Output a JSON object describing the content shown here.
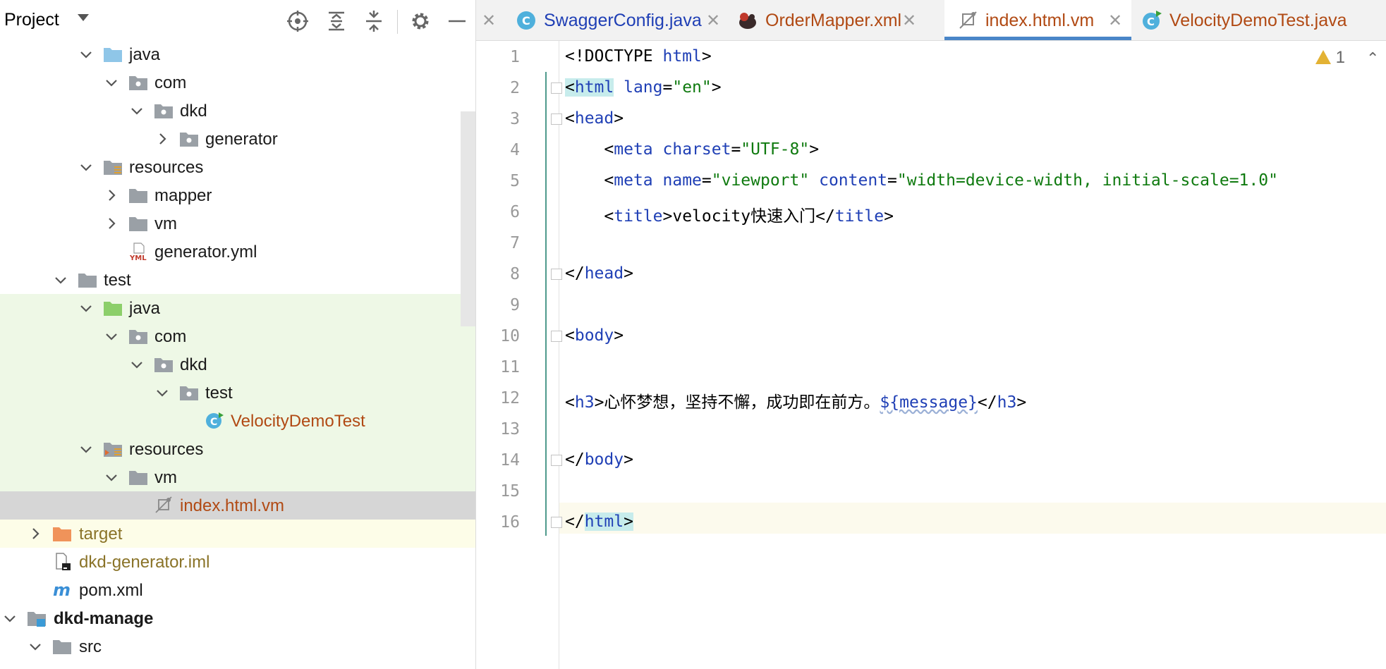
{
  "project_panel": {
    "title": "Project"
  },
  "tree": [
    {
      "label": "java",
      "type": "folder-blue",
      "expanded": true
    },
    {
      "label": "com",
      "type": "package",
      "expanded": true
    },
    {
      "label": "dkd",
      "type": "package",
      "expanded": true
    },
    {
      "label": "generator",
      "type": "package",
      "expanded": false
    },
    {
      "label": "resources",
      "type": "resources-folder",
      "expanded": true
    },
    {
      "label": "mapper",
      "type": "folder",
      "expanded": false
    },
    {
      "label": "vm",
      "type": "folder",
      "expanded": false
    },
    {
      "label": "generator.yml",
      "type": "yml-file"
    },
    {
      "label": "test",
      "type": "folder",
      "expanded": true
    },
    {
      "label": "java",
      "type": "folder-green",
      "expanded": true
    },
    {
      "label": "com",
      "type": "package",
      "expanded": true
    },
    {
      "label": "dkd",
      "type": "package",
      "expanded": true
    },
    {
      "label": "test",
      "type": "package",
      "expanded": true
    },
    {
      "label": "VelocityDemoTest",
      "type": "test-class"
    },
    {
      "label": "resources",
      "type": "test-resources-folder",
      "expanded": true
    },
    {
      "label": "vm",
      "type": "folder",
      "expanded": true
    },
    {
      "label": "index.html.vm",
      "type": "vm-file"
    },
    {
      "label": "target",
      "type": "folder-orange",
      "expanded": false
    },
    {
      "label": "dkd-generator.iml",
      "type": "iml-file"
    },
    {
      "label": "pom.xml",
      "type": "maven-file"
    },
    {
      "label": "dkd-manage",
      "type": "module",
      "expanded": true
    },
    {
      "label": "src",
      "type": "folder",
      "expanded": true
    }
  ],
  "tabs": [
    {
      "label": "SwaggerConfig.java",
      "icon": "class-icon"
    },
    {
      "label": "OrderMapper.xml",
      "icon": "mybatis-icon"
    },
    {
      "label": "index.html.vm",
      "icon": "vm-file-icon"
    },
    {
      "label": "VelocityDemoTest.java",
      "icon": "test-class-icon"
    }
  ],
  "editor": {
    "warning_count": "1",
    "line_numbers": [
      "1",
      "2",
      "3",
      "4",
      "5",
      "6",
      "7",
      "8",
      "9",
      "10",
      "11",
      "12",
      "13",
      "14",
      "15",
      "16"
    ],
    "lines": {
      "l1_a": "<!DOCTYPE ",
      "l1_b": "html",
      "l1_c": ">",
      "l2_a": "<",
      "l2_b": "html",
      "l2_c": " ",
      "l2_d": "lang",
      "l2_e": "=",
      "l2_f": "\"en\"",
      "l2_g": ">",
      "l3_a": "<",
      "l3_b": "head",
      "l3_c": ">",
      "l4_a": "    <",
      "l4_b": "meta",
      "l4_c": " ",
      "l4_d": "charset",
      "l4_e": "=",
      "l4_f": "\"UTF-8\"",
      "l4_g": ">",
      "l5_a": "    <",
      "l5_b": "meta",
      "l5_c": " ",
      "l5_d": "name",
      "l5_e": "=",
      "l5_f": "\"viewport\"",
      "l5_g": " ",
      "l5_h": "content",
      "l5_i": "=",
      "l5_j": "\"width=device-width, initial-scale=1.0\"",
      "l6_a": "    <",
      "l6_b": "title",
      "l6_c": ">velocity快速入门</",
      "l6_d": "title",
      "l6_e": ">",
      "l8_a": "</",
      "l8_b": "head",
      "l8_c": ">",
      "l10_a": "<",
      "l10_b": "body",
      "l10_c": ">",
      "l12_a": "<",
      "l12_b": "h3",
      "l12_c": ">心怀梦想，坚持不懈，成功即在前方。",
      "l12_d": "${message}",
      "l12_e": "</",
      "l12_f": "h3",
      "l12_g": ">",
      "l14_a": "</",
      "l14_b": "body",
      "l14_c": ">",
      "l16_a": "</",
      "l16_b": "html",
      "l16_c": ">"
    }
  },
  "colors": {
    "tag": "#1f3fb5",
    "string": "#0f7a0f",
    "test_background": "#eef8e6",
    "selected_row": "#d6d6d6",
    "active_tab_underline": "#4a86c8"
  }
}
